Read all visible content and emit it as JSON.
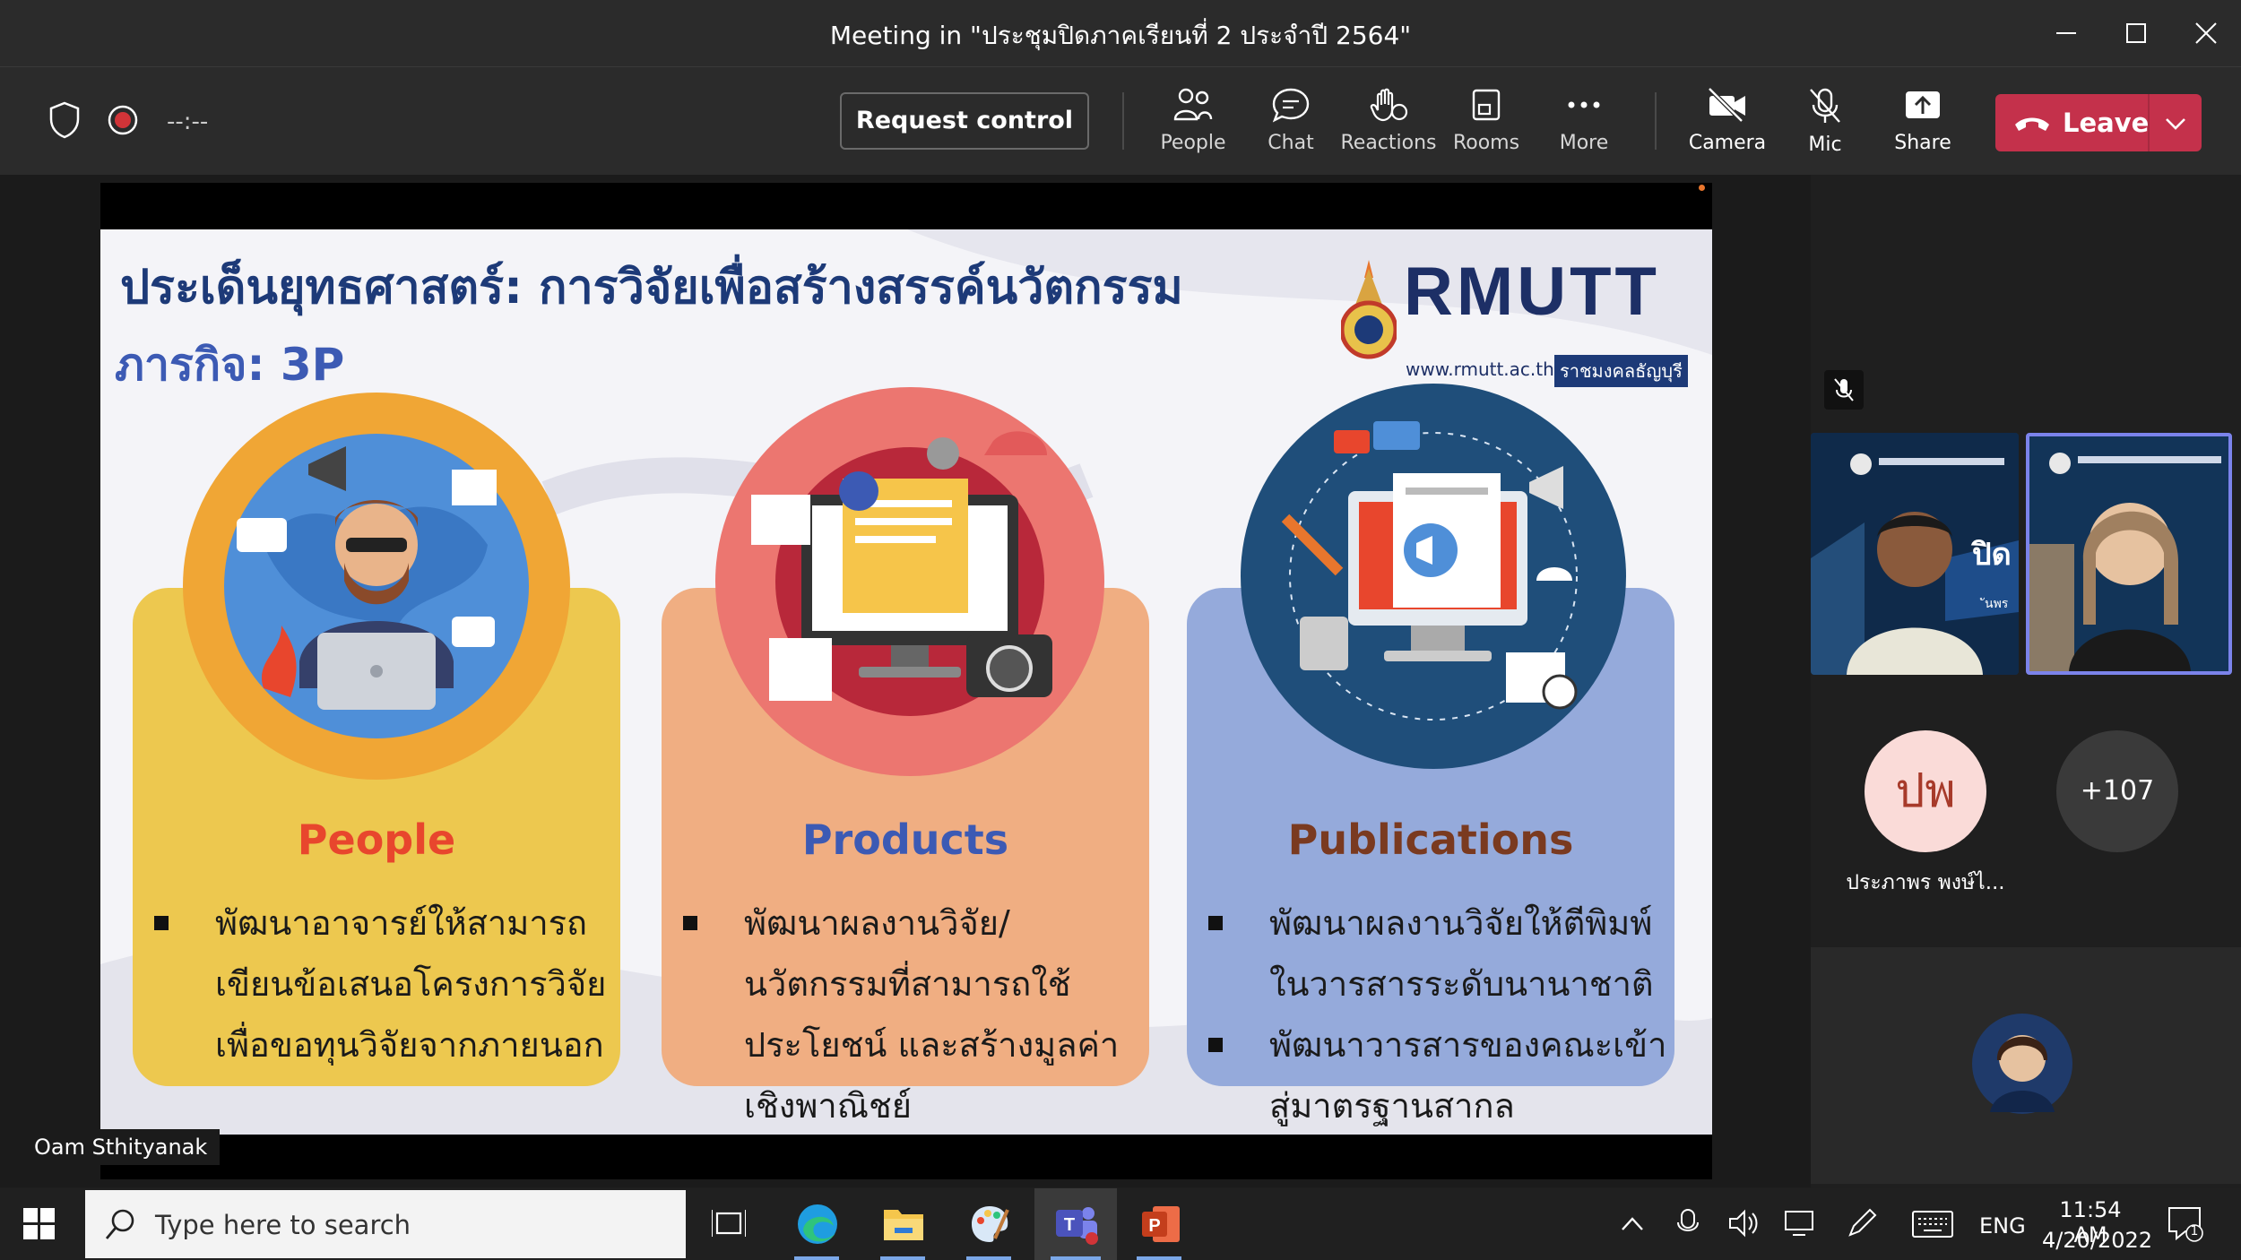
{
  "window": {
    "title": "Meeting in \"ประชุมปิดภาคเรียนที่ 2 ประจำปี 2564\""
  },
  "toolbar": {
    "timer": "--:--",
    "request_control": "Request control",
    "tools": [
      {
        "label": "People",
        "icon": "people-icon"
      },
      {
        "label": "Chat",
        "icon": "chat-icon"
      },
      {
        "label": "Reactions",
        "icon": "reactions-icon"
      },
      {
        "label": "Rooms",
        "icon": "rooms-icon"
      },
      {
        "label": "More",
        "icon": "more-icon"
      }
    ],
    "media": [
      {
        "label": "Camera",
        "icon": "camera-off-icon"
      },
      {
        "label": "Mic",
        "icon": "mic-off-icon"
      },
      {
        "label": "Share",
        "icon": "share-icon"
      }
    ],
    "leave": "Leave",
    "leave_color": "#c4314b"
  },
  "slide": {
    "title": "ประเด็นยุทธศาสตร์: การวิจัยเพื่อสร้างสรรค์นวัตกรรม",
    "subtitle": "ภารกิจ: 3P",
    "logo": {
      "brand": "RMUTT",
      "url": "www.rmutt.ac.th",
      "tag": "ราชมงคลธัญบุรี"
    },
    "cards": [
      {
        "heading": "People",
        "heading_color": "#e8462d",
        "bullets": [
          [
            "พัฒนาอาจารย์ให้สามารถ",
            "เขียนข้อเสนอโครงการวิจัย",
            "เพื่อขอทุนวิจัยจากภายนอก"
          ]
        ]
      },
      {
        "heading": "Products",
        "heading_color": "#3c5ab4",
        "bullets": [
          [
            "พัฒนาผลงานวิจัย/",
            "นวัตกรรมที่สามารถใช้",
            "ประโยชน์ และสร้างมูลค่า",
            "เชิงพาณิชย์"
          ]
        ]
      },
      {
        "heading": "Publications",
        "heading_color": "#7a3a20",
        "bullets": [
          [
            "พัฒนาผลงานวิจัยให้ตีพิมพ์",
            "ในวารสารระดับนานาชาติ"
          ],
          [
            "พัฒนาวารสารของคณะเข้า",
            "สู่มาตรฐานสากล"
          ]
        ]
      }
    ]
  },
  "speaker_name": "Oam Sthityanak",
  "participants": {
    "avatar_initials": "ปพ",
    "avatar_name": "ประภาพร พงษ์ไ...",
    "more_count": "+107",
    "tile_overlay_text": "ปิด",
    "tile_overlay_text2": "ันพร"
  },
  "taskbar": {
    "search_placeholder": "Type here to search",
    "lang": "ENG",
    "time": "11:54 AM",
    "date": "4/20/2022",
    "notifications": "1"
  }
}
